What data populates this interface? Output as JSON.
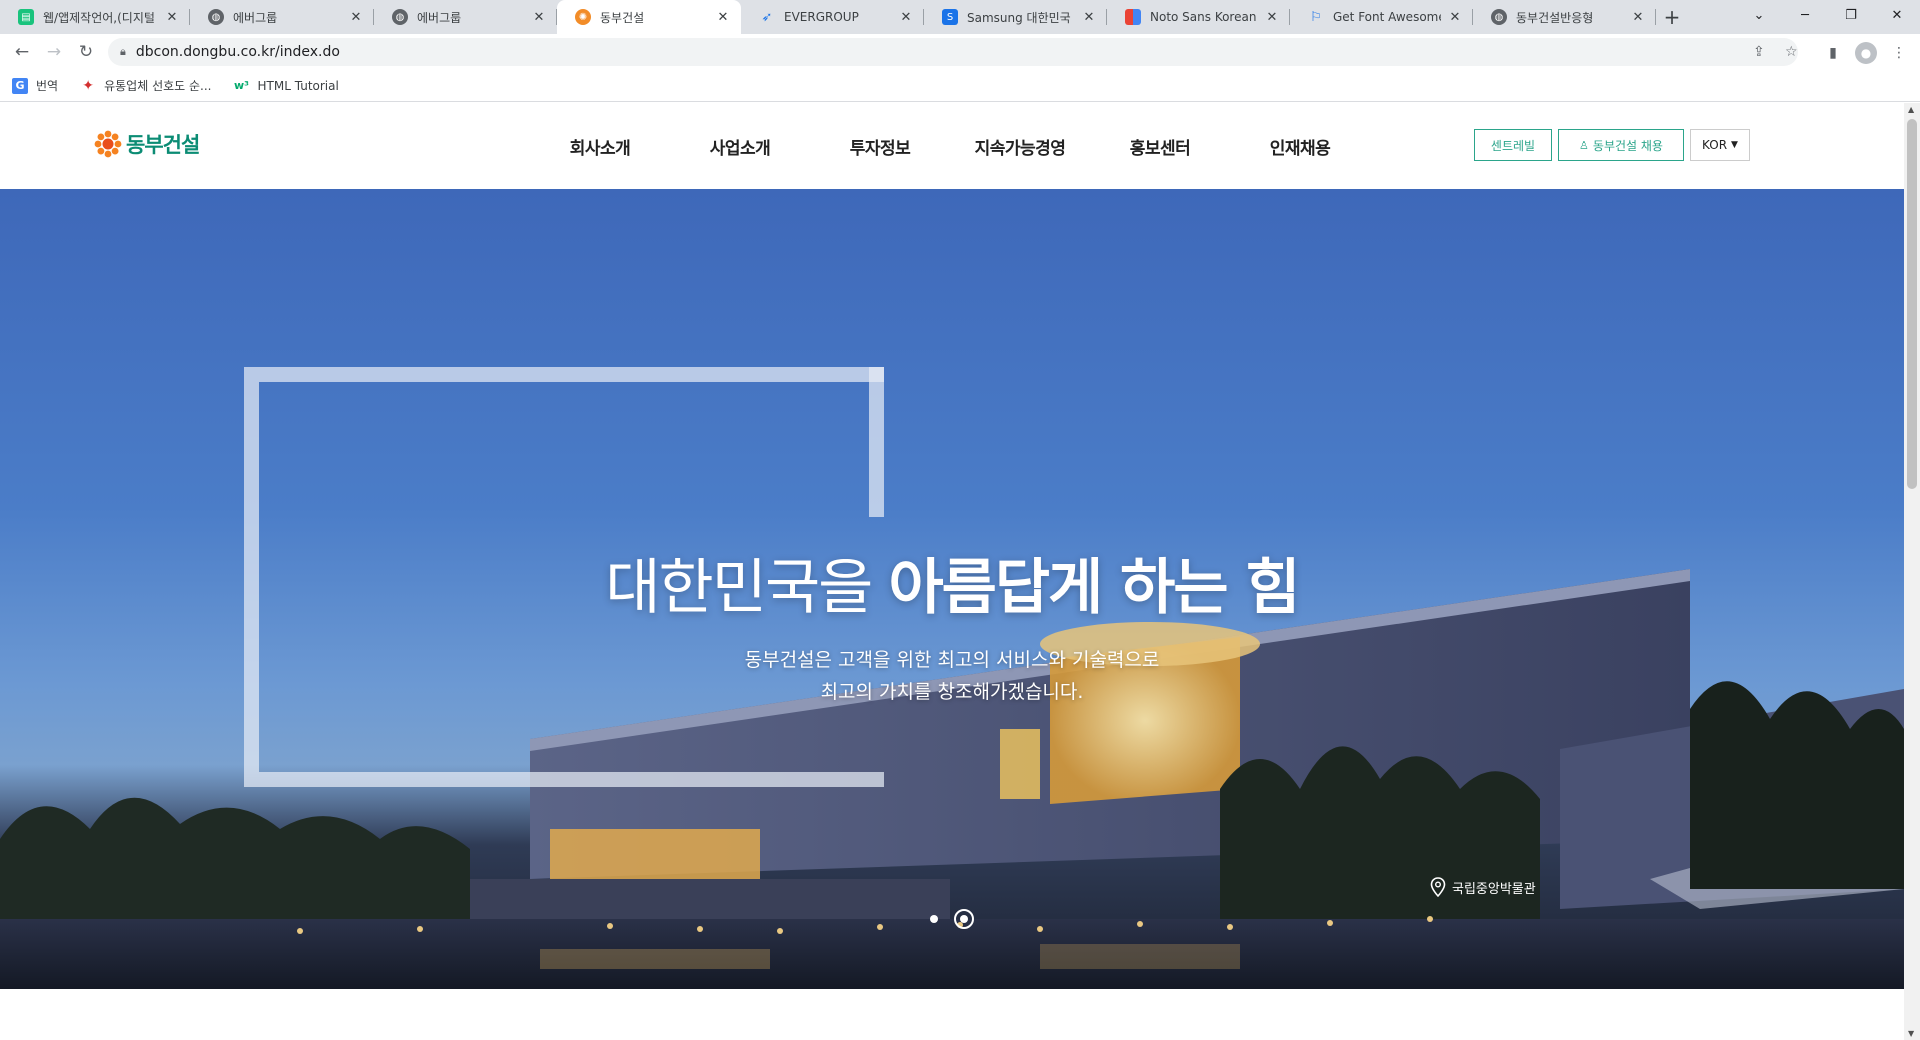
{
  "browser": {
    "tabs": [
      {
        "label": "웹/앱제작언어,(디지털",
        "favicon": "green-doc-icon",
        "active": false
      },
      {
        "label": "에버그룹",
        "favicon": "globe-icon",
        "active": false
      },
      {
        "label": "에버그룹",
        "favicon": "globe-icon",
        "active": false
      },
      {
        "label": "동부건설",
        "favicon": "dongbu-flower-icon",
        "active": true
      },
      {
        "label": "EVERGROUP",
        "favicon": "evergroup-icon",
        "active": false
      },
      {
        "label": "Samsung 대한민국 | 삼",
        "favicon": "samsung-s-icon",
        "active": false
      },
      {
        "label": "Noto Sans Korean - G",
        "favicon": "google-fonts-icon",
        "active": false
      },
      {
        "label": "Get Font Awesome Fr",
        "favicon": "flag-icon",
        "active": false
      },
      {
        "label": "동부건설반응형",
        "favicon": "globe-icon",
        "active": false
      }
    ],
    "new_tab": "+",
    "url": "dbcon.dongbu.co.kr/index.do",
    "bookmarks": [
      {
        "label": "번역",
        "icon": "google-translate-icon"
      },
      {
        "label": "유통업체 선호도 순...",
        "icon": "maple-leaf-icon"
      },
      {
        "label": "HTML Tutorial",
        "icon": "w3schools-icon"
      }
    ]
  },
  "site": {
    "logo_text": "동부건설",
    "brand_color": "#0b8c74",
    "accent_color": "#2ba58b",
    "nav": [
      "회사소개",
      "사업소개",
      "투자정보",
      "지속가능경영",
      "홍보센터",
      "인재채용"
    ],
    "header_buttons": {
      "centreville": "센트레빌",
      "recruit": "동부건설 채용"
    },
    "language": "KOR"
  },
  "hero": {
    "title_light": "대한민국을 ",
    "title_bold": "아름답게 하는 힘",
    "subtitle_line1": "동부건설은 고객을 위한 최고의 서비스와 기술력으로",
    "subtitle_line2": "최고의 가치를 창조해가겠습니다.",
    "location": "국립중앙박물관",
    "slides_total": 2,
    "slide_active": 2
  }
}
